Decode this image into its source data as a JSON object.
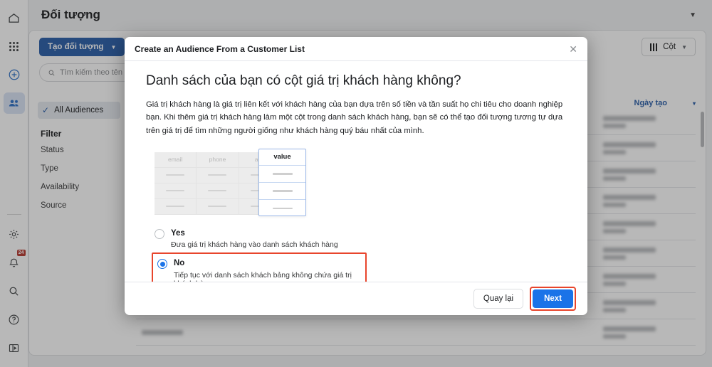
{
  "sidebar": {
    "items": [
      {
        "icon": "home-icon",
        "label": "Home"
      },
      {
        "icon": "apps-grid-icon",
        "label": "All tools"
      },
      {
        "icon": "plus-circle-icon",
        "label": "Create"
      },
      {
        "icon": "audiences-people-icon",
        "label": "Audiences"
      }
    ],
    "bottom_items": [
      {
        "icon": "gear-icon",
        "label": "Settings"
      },
      {
        "icon": "bell-icon",
        "label": "Notifications",
        "badge": "24"
      },
      {
        "icon": "search-icon",
        "label": "Search"
      },
      {
        "icon": "help-circle-icon",
        "label": "Help"
      },
      {
        "icon": "panel-icon",
        "label": "Panel"
      }
    ]
  },
  "header": {
    "page_title": "Đối tượng",
    "chevron": "▼"
  },
  "toolbar": {
    "create_audience_label": "Tạo đối tượng",
    "create_audience_caret": "▼",
    "columns_label": "Cột",
    "columns_caret": "▼",
    "search_placeholder": "Tìm kiếm theo tên ho",
    "search_icon": "search-icon"
  },
  "filters": {
    "all_audiences_label": "All Audiences",
    "all_audiences_check": "✓",
    "filter_heading": "Filter",
    "items": [
      "Status",
      "Type",
      "Availability",
      "Source"
    ]
  },
  "table": {
    "sort_column_label": "Ngày tạo",
    "sort_caret": "▾",
    "row_count": 9
  },
  "modal": {
    "title": "Create an Audience From a Customer List",
    "close_icon": "✕",
    "heading": "Danh sách của bạn có cột giá trị khách hàng không?",
    "description": "Giá trị khách hàng là giá trị liên kết với khách hàng của bạn dựa trên số tiền và tần suất họ chi tiêu cho doanh nghiệp bạn. Khi thêm giá trị khách hàng làm một cột trong danh sách khách hàng, bạn sẽ có thể tạo đối tượng tương tự dựa trên giá trị để tìm những người giống như khách hàng quý báu nhất của mình.",
    "illustration": {
      "ghost_columns": [
        "email",
        "phone",
        "age"
      ],
      "value_column_header": "value",
      "ghost_rows": 3,
      "value_rows": 3
    },
    "options": [
      {
        "value": "yes",
        "label": "Yes",
        "sublabel": "Đưa giá trị khách hàng vào danh sách khách hàng",
        "selected": false,
        "highlighted": false
      },
      {
        "value": "no",
        "label": "No",
        "sublabel": "Tiếp tục với danh sách khách bảng không chứa giá trị khách hàng",
        "selected": true,
        "highlighted": true
      }
    ],
    "footer": {
      "back_label": "Quay lại",
      "next_label": "Next"
    }
  },
  "colors": {
    "accent_blue": "#1a73e8",
    "brand_blue": "#1a5fc4",
    "annotation_red": "#e8452c",
    "badge_red": "#d93025"
  }
}
